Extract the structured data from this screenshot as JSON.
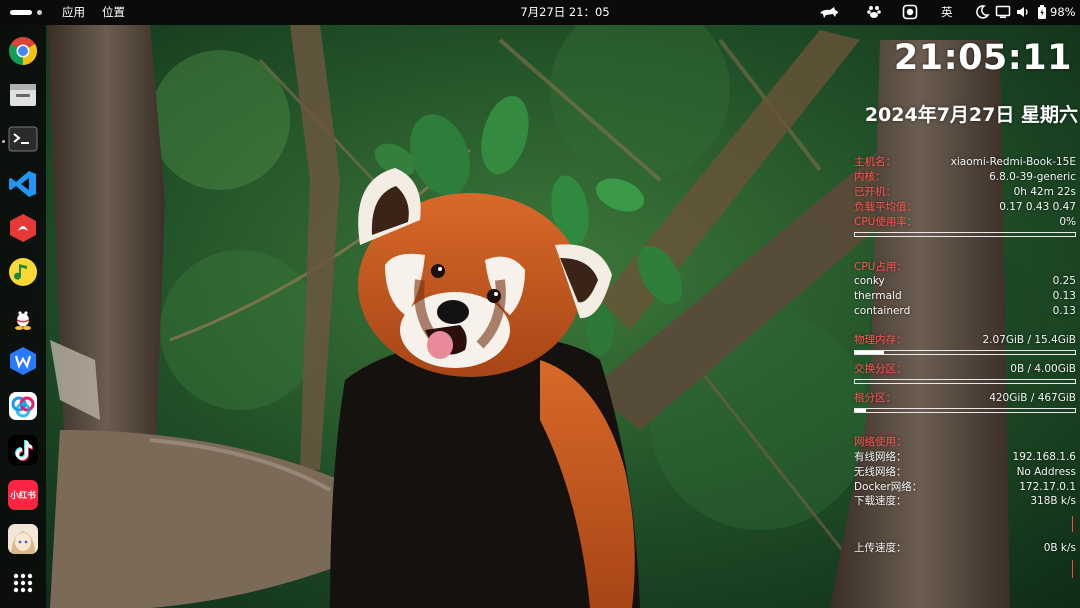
{
  "topbar": {
    "menu_apps": "应用",
    "menu_places": "位置",
    "clock": "7月27日 21：05",
    "input_method": "英",
    "battery": "98%",
    "icons": [
      "cat-icon",
      "paw-icon",
      "record-icon",
      "moon-icon",
      "display-icon",
      "volume-icon",
      "battery-icon"
    ]
  },
  "dock": {
    "apps": [
      {
        "name": "chrome-icon"
      },
      {
        "name": "files-icon"
      },
      {
        "name": "terminal-icon"
      },
      {
        "name": "vscode-icon"
      },
      {
        "name": "huawei-icon"
      },
      {
        "name": "music-icon"
      },
      {
        "name": "qq-icon"
      },
      {
        "name": "wps-icon"
      },
      {
        "name": "baidu-netdisk-icon"
      },
      {
        "name": "tiktok-icon"
      },
      {
        "name": "xiaohongshu-icon",
        "label": "小红书"
      },
      {
        "name": "anime-avatar-icon"
      },
      {
        "name": "app-grid-icon"
      }
    ]
  },
  "conky": {
    "time": "21:05:11",
    "date": "2024年7月27日 星期六",
    "system": [
      {
        "label": "主机名：",
        "value": "xiaomi-Redmi-Book-15E"
      },
      {
        "label": "内核：",
        "value": "6.8.0-39-generic"
      },
      {
        "label": "已开机：",
        "value": "0h 42m 22s"
      },
      {
        "label": "负载平均值：",
        "value": "0.17 0.43 0.47"
      },
      {
        "label": "CPU使用率：",
        "value": "0%"
      }
    ],
    "cpu_percent": 0,
    "cpu_section": "CPU占用：",
    "processes": [
      {
        "name": "conky",
        "value": "0.25"
      },
      {
        "name": "thermald",
        "value": "0.13"
      },
      {
        "name": "containerd",
        "value": "0.13"
      }
    ],
    "memory": {
      "label": "物理内存：",
      "value": "2.07GiB / 15.4GiB",
      "fraction": 0.134
    },
    "swap": {
      "label": "交换分区：",
      "value": "0B / 4.00GiB",
      "fraction": 0
    },
    "root": {
      "label": "根分区：",
      "value": "420GiB / 467GiB",
      "fraction": 0.05
    },
    "network_section": "网络使用：",
    "network": [
      {
        "label": "有线网络：",
        "value": "192.168.1.6"
      },
      {
        "label": "无线网络：",
        "value": "No Address"
      },
      {
        "label": "Docker网络：",
        "value": "172.17.0.1"
      },
      {
        "label": "下载速度：",
        "value": "318B k/s"
      }
    ],
    "upload": {
      "label": "上传速度：",
      "value": "0B k/s"
    }
  },
  "colors": {
    "conky_label": "#ff5252",
    "topbar_bg": "#0b0b0b",
    "dock_bg": "#0a0a0a"
  }
}
